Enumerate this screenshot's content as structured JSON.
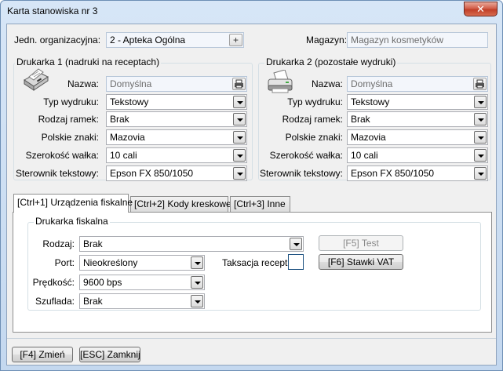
{
  "window": {
    "title": "Karta stanowiska nr 3",
    "close_glyph": "✕"
  },
  "top": {
    "org_label": "Jedn. organizacyjna:",
    "org_value": "2 - Apteka Ogólna",
    "org_button_glyph": "+",
    "warehouse_label": "Magazyn:",
    "warehouse_value": "Magazyn kosmetyków"
  },
  "printer1": {
    "group_title": "Drukarka 1 (nadruki na receptach)",
    "icon": "dot-matrix-printer-icon",
    "name_label": "Nazwa:",
    "name_value": "Domyślna",
    "type_label": "Typ wydruku:",
    "type_value": "Tekstowy",
    "frames_label": "Rodzaj ramek:",
    "frames_value": "Brak",
    "chars_label": "Polskie znaki:",
    "chars_value": "Mazovia",
    "width_label": "Szerokość wałka:",
    "width_value": "10 cali",
    "driver_label": "Sterownik tekstowy:",
    "driver_value": "Epson FX 850/1050"
  },
  "printer2": {
    "group_title": "Drukarka 2 (pozostałe wydruki)",
    "icon": "inkjet-printer-icon",
    "name_label": "Nazwa:",
    "name_value": "Domyślna",
    "type_label": "Typ wydruku:",
    "type_value": "Tekstowy",
    "frames_label": "Rodzaj ramek:",
    "frames_value": "Brak",
    "chars_label": "Polskie znaki:",
    "chars_value": "Mazovia",
    "width_label": "Szerokość wałka:",
    "width_value": "10 cali",
    "driver_label": "Sterownik tekstowy:",
    "driver_value": "Epson FX 850/1050"
  },
  "tabs": [
    {
      "label": "[Ctrl+1] Urządzenia fiskalne",
      "active": true
    },
    {
      "label": "[Ctrl+2] Kody kreskowe",
      "active": false
    },
    {
      "label": "[Ctrl+3] Inne",
      "active": false
    }
  ],
  "fiscal": {
    "group_title": "Drukarka fiskalna",
    "kind_label": "Rodzaj:",
    "kind_value": "Brak",
    "port_label": "Port:",
    "port_value": "Nieokreślony",
    "speed_label": "Prędkość:",
    "speed_value": "9600 bps",
    "drawer_label": "Szuflada:",
    "drawer_value": "Brak",
    "taxation_label": "Taksacja recept:",
    "taxation_checked": false,
    "test_button": "[F5] Test",
    "vat_button": "[F6] Stawki VAT"
  },
  "footer": {
    "change_button": "[F4] Zmień",
    "close_button": "[ESC] Zamknij"
  },
  "colors": {
    "title_gradient_top": "#d7e6f7",
    "close_red": "#c13f28",
    "client_bg": "#f0f0f0"
  }
}
